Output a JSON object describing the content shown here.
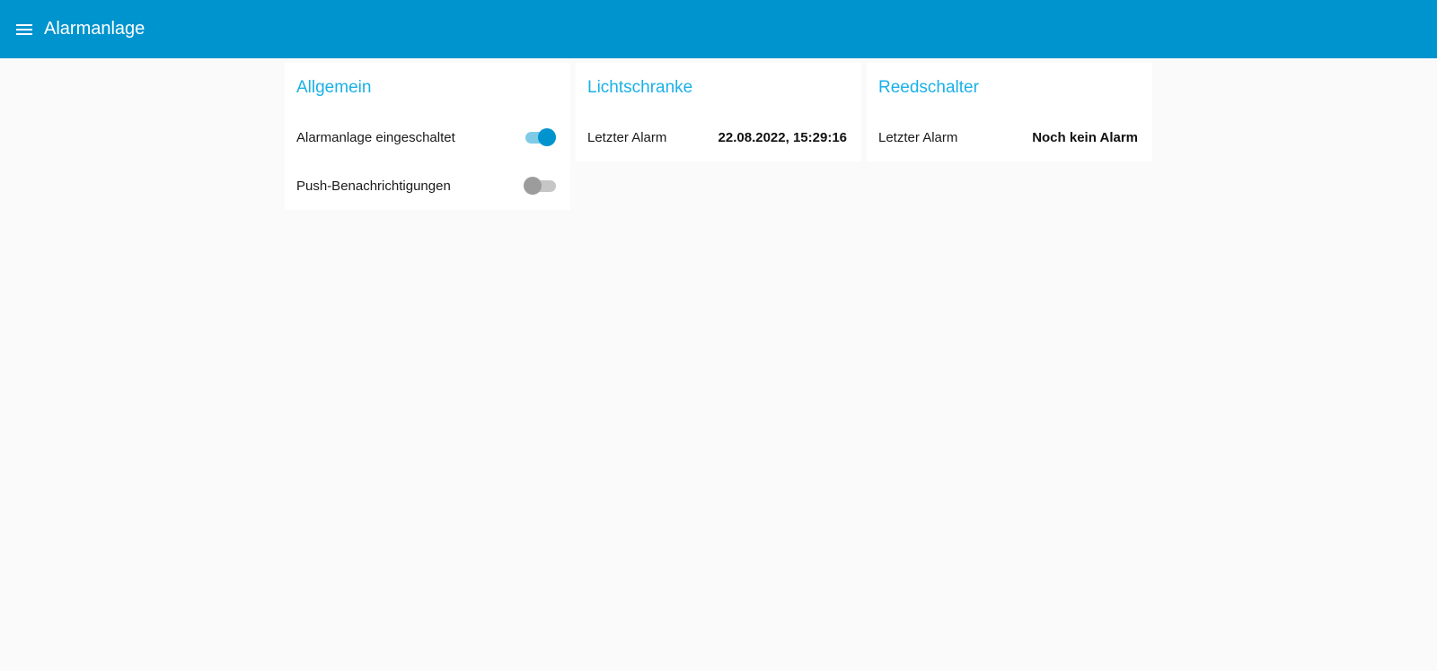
{
  "header": {
    "title": "Alarmanlage",
    "bg_color": "#0094ce"
  },
  "cards": {
    "allgemein": {
      "title": "Allgemein",
      "rows": [
        {
          "label": "Alarmanlage eingeschaltet",
          "state": "on"
        },
        {
          "label": "Push-Benachrichtigungen",
          "state": "off"
        }
      ]
    },
    "lichtschranke": {
      "title": "Lichtschranke",
      "label": "Letzter Alarm",
      "value": "22.08.2022, 15:29:16"
    },
    "reedschalter": {
      "title": "Reedschalter",
      "label": "Letzter Alarm",
      "value": "Noch kein Alarm"
    }
  },
  "colors": {
    "accent": "#0094ce",
    "card_title": "#1ab0e8",
    "background": "#fafafa"
  }
}
